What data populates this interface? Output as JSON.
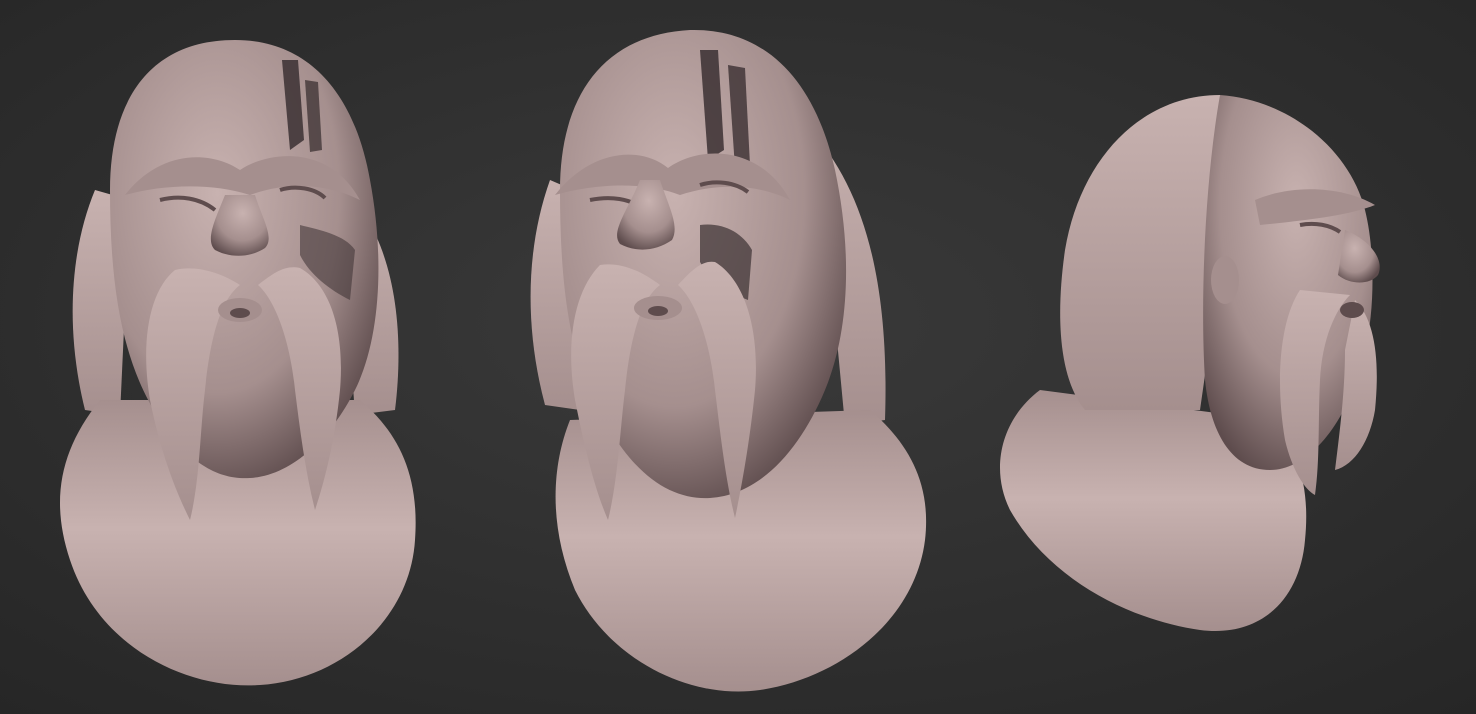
{
  "scene": {
    "background": {
      "color_center": "#3a3a3a",
      "color_edge": "#262626"
    },
    "material": {
      "clay_light": "#c8b2b0",
      "clay_mid": "#a58f8e",
      "clay_dark": "#5e4c4d",
      "war_paint": "#3b3032"
    },
    "views": [
      {
        "id": "front",
        "label": ""
      },
      {
        "id": "three-quarter",
        "label": ""
      },
      {
        "id": "side",
        "label": ""
      }
    ]
  }
}
